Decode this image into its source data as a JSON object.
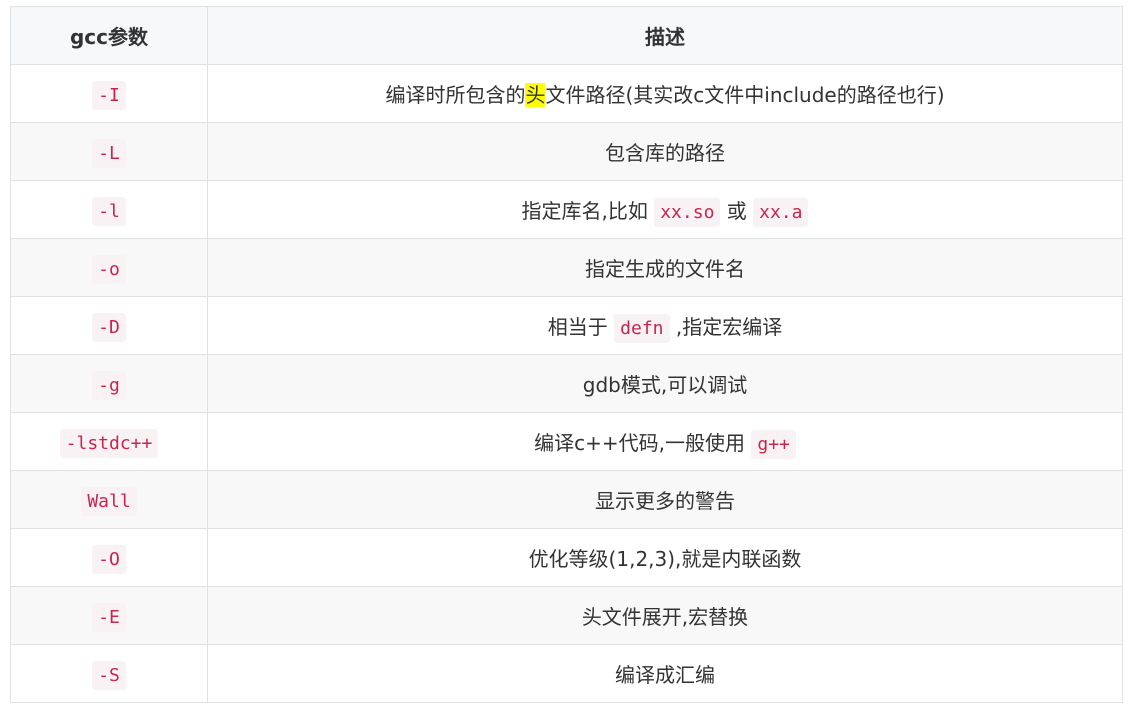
{
  "table": {
    "headers": [
      "gcc参数",
      "描述"
    ],
    "rows": [
      {
        "param": "-I",
        "desc": [
          {
            "t": "编译时所包含的"
          },
          {
            "t": "头",
            "mark": true
          },
          {
            "t": "文件路径(其实改c文件中include的路径也行)"
          }
        ]
      },
      {
        "param": "-L",
        "desc": [
          {
            "t": "包含库的路径"
          }
        ]
      },
      {
        "param": "-l",
        "desc": [
          {
            "t": "指定库名,比如 "
          },
          {
            "t": "xx.so",
            "code": true
          },
          {
            "t": " 或 "
          },
          {
            "t": "xx.a",
            "code": true
          }
        ]
      },
      {
        "param": "-o",
        "desc": [
          {
            "t": "指定生成的文件名"
          }
        ]
      },
      {
        "param": "-D",
        "desc": [
          {
            "t": "相当于 "
          },
          {
            "t": "defn",
            "code": true
          },
          {
            "t": " ,指定宏编译"
          }
        ]
      },
      {
        "param": "-g",
        "desc": [
          {
            "t": "gdb模式,可以调试"
          }
        ]
      },
      {
        "param": "-lstdc++",
        "desc": [
          {
            "t": "编译c++代码,一般使用 "
          },
          {
            "t": "g++",
            "code": true
          }
        ]
      },
      {
        "param": "Wall",
        "desc": [
          {
            "t": "显示更多的警告"
          }
        ]
      },
      {
        "param": "-O",
        "desc": [
          {
            "t": "优化等级(1,2,3),就是内联函数"
          }
        ]
      },
      {
        "param": "-E",
        "desc": [
          {
            "t": "头文件展开,宏替换"
          }
        ]
      },
      {
        "param": "-S",
        "desc": [
          {
            "t": "编译成汇编"
          }
        ]
      }
    ]
  },
  "colors": {
    "header_bg": "#f6f8fa",
    "border": "#dfe2e5",
    "code_text": "#c7254e",
    "code_bg": "#f9f2f4",
    "highlight": "#ffff00"
  }
}
